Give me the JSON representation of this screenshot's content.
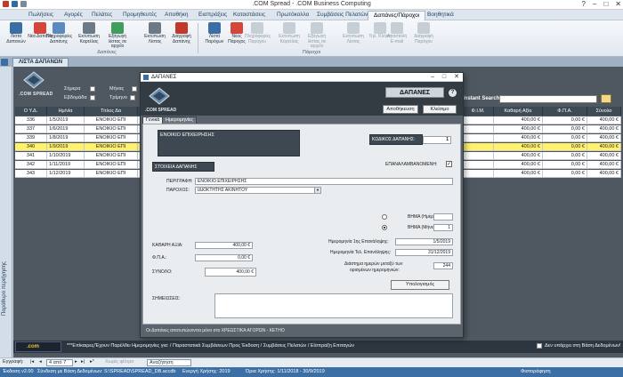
{
  "window": {
    "title": ".COM Spread - .COM Business Computing"
  },
  "menu": {
    "tabs": [
      "Πωλήσεις",
      "Αγορές",
      "Πελάτες",
      "Προμηθευτές",
      "Αποθήκη",
      "Εισπράξεις",
      "Καταστάσεις",
      "Πρωτόκολλο",
      "Συμβάσεις Πελατών",
      "Δαπάνες/Πάροχοι",
      "Βοηθητικά"
    ],
    "active_index": 9
  },
  "ribbon": {
    "buttons": [
      {
        "label": "Λίστα Δαπανών",
        "icon": "list-icon",
        "enabled": true
      },
      {
        "label": "Νέα Δαπάνη",
        "icon": "add-icon",
        "enabled": true
      },
      {
        "label": "Πληροφορίες Δαπάνης",
        "icon": "info-icon",
        "enabled": true
      },
      {
        "label": "Εκτύπωση Καρτέλας",
        "icon": "print-icon",
        "enabled": true
      },
      {
        "label": "Εξαγωγή λίστας σε αρχείο",
        "icon": "export-icon",
        "enabled": true
      },
      {
        "label": "Εκτύπωση Λίστας",
        "icon": "print-list-icon",
        "enabled": true
      },
      {
        "label": "Διαγραφή Δαπάνης",
        "icon": "delete-icon",
        "enabled": true
      },
      {
        "label": "Λίστα Παρόχων",
        "icon": "list-icon",
        "enabled": true
      },
      {
        "label": "Νέος Πάροχος",
        "icon": "add-icon",
        "enabled": true
      },
      {
        "label": "Πληροφορίες Παρόχου",
        "icon": "info-icon",
        "enabled": false
      },
      {
        "label": "Εκτύπωση Καρτέλας",
        "icon": "print-icon",
        "enabled": false
      },
      {
        "label": "Εξαγωγή λίστας σε αρχείο",
        "icon": "export-icon",
        "enabled": false
      },
      {
        "label": "Εκτύπωση Λίστας",
        "icon": "print-list-icon",
        "enabled": false
      },
      {
        "label": "Τηλ. Κλήση",
        "icon": "phone-icon",
        "enabled": false
      },
      {
        "label": "Αποστολή E-mail",
        "icon": "mail-icon",
        "enabled": false
      },
      {
        "label": "Διαγραφή Παρόχου",
        "icon": "delete-icon",
        "enabled": false
      }
    ],
    "groups": [
      "Δαπάνες",
      "Πάροχοι"
    ]
  },
  "doc_tab": {
    "label": "ΛΙΣΤΑ ΔΑΠΑΝΩΝ"
  },
  "left_panel": {
    "label": "Παράθυρο περιήγησης"
  },
  "list": {
    "logo_text": ".COM SPREAD",
    "filters": [
      "Σήμερα",
      "Εβδομάδα",
      "Μήνας",
      "Τρίμηνο"
    ],
    "search_label": "Instant Search:",
    "columns": [
      "Ο Υ.Δ.",
      "Ημ/νία",
      "Τίτλος Δα",
      "Φ.Ι.Μ.",
      "Καθαρή Αξία",
      "Φ.Π.Α.",
      "Σύνολο"
    ],
    "rows": [
      {
        "id": "336",
        "date": "1/5/2019",
        "title": "ΕΝΟΙΚΙΟ ΕΠΙ",
        "net": "400,00 €",
        "vat": "0,00 €",
        "total": "400,00 €",
        "selected": false
      },
      {
        "id": "337",
        "date": "1/6/2019",
        "title": "ΕΝΟΙΚΙΟ ΕΠΙ",
        "net": "400,00 €",
        "vat": "0,00 €",
        "total": "400,00 €",
        "selected": false
      },
      {
        "id": "339",
        "date": "1/8/2019",
        "title": "ΕΝΟΙΚΙΟ ΕΠΙ",
        "net": "400,00 €",
        "vat": "0,00 €",
        "total": "400,00 €",
        "selected": false
      },
      {
        "id": "340",
        "date": "1/9/2019",
        "title": "ΕΝΟΙΚΙΟ ΕΠΙ",
        "net": "400,00 €",
        "vat": "0,00 €",
        "total": "400,00 €",
        "selected": true
      },
      {
        "id": "341",
        "date": "1/10/2019",
        "title": "ΕΝΟΙΚΙΟ ΕΠΙ",
        "net": "400,00 €",
        "vat": "0,00 €",
        "total": "400,00 €",
        "selected": false
      },
      {
        "id": "342",
        "date": "1/11/2019",
        "title": "ΕΝΟΙΚΙΟ ΕΠΙ",
        "net": "400,00 €",
        "vat": "0,00 €",
        "total": "400,00 €",
        "selected": false
      },
      {
        "id": "343",
        "date": "1/12/2019",
        "title": "ΕΝΟΙΚΙΟ ΕΠΙ",
        "net": "400,00 €",
        "vat": "0,00 €",
        "total": "400,00 €",
        "selected": false
      }
    ]
  },
  "ticker": {
    "logo": ".com",
    "text": "***Επίκαιρες/Έχουν Παρέλθει Ημερομηνίες για: / Παραστατικά Συμβάσεων Προς Έκδοση / Συμβάσεις Πελατών / Είσπραξη Επιταγών",
    "checkbox_label": "Δεν υπάρχει στη Βάση Δεδομένων!"
  },
  "recnav": {
    "label": "Εγγραφή:",
    "position": "4 από 7",
    "filter": "Χωρίς φίλτρο",
    "search": "Αναζήτηση"
  },
  "statusbar": {
    "version": "Έκδοση v2.00",
    "db": "Σύνδεση με Βάση Δεδομένων: S:\\SPREAD\\SPREAD_DB.accdb",
    "year": "Ενεργή Χρήσης: 2019",
    "period": "Όρια Χρήσης: 1/11/2018 - 30/9/2019",
    "mode": "Φύλλο Δεδομένων",
    "numlock": "Φιστοράφηση"
  },
  "dialog": {
    "title": "ΔΑΠΑΝΕΣ",
    "logo_text": ".COM SPREAD",
    "banner": "ΔΑΠΑΝΕΣ",
    "help": "?",
    "save_label": "Αποθήκευση",
    "close_label": "Κλείσιμο",
    "tabs": [
      "Γενικά",
      "Ημερομηνίες"
    ],
    "header_title": "ΕΝΟΙΚΙΟ ΕΠΙΧΕΙΡΗΣΗΣ",
    "code_label": "ΚΩΔΙΚΟΣ ΔΑΠΑΝΗΣ:",
    "code_value": "1",
    "section_label": "ΣΤΟΙΧΕΙΑ ΔΑΠΑΝΗΣ",
    "recurring_label": "ΕΠΑΝΑΛΑΜΒΑΝΟΜΕΝΗ:",
    "description_label": "ΠΕΡΙΓΡΑΦΗ:",
    "description_value": "ΕΝΟΙΚΙΟ ΕΠΙΧΕΙΡΗΣΗΣ",
    "provider_label": "ΠΑΡΟΧΟΣ:",
    "provider_value": "ΙΔΙΟΚΤΗΤΗΣ ΑΚΙΝΗΤΟΥ",
    "step_days_label": "ΒΗΜΑ (Ημέρες):",
    "step_days_value": "",
    "step_months_label": "ΒΗΜΑ (Μήνες):",
    "step_months_value": "1",
    "first_date_label": "Ημερομηνία 1ης Επανάληψης:",
    "first_date_value": "1/5/2019",
    "last_date_label": "Ημερομηνία Τελ. Επανάληψης:",
    "last_date_value": "31/12/2019",
    "interval_label_1": "Διάστημα ημερών μεταξύ των",
    "interval_label_2": "ορισμένων ημερομηνιών:",
    "interval_value": "244",
    "net_label": "ΚΑΘΑΡΗ ΑΞΙΑ:",
    "net_value": "400,00 €",
    "vat_label": "Φ.Π.Α.:",
    "vat_value": "0,00 €",
    "total_label": "ΣΥΝΟΛΟ:",
    "total_value": "400,00 €",
    "calc_label": "Υπολογισμός",
    "notes_label": "ΣΗΜΕΙΩΣΕΙΣ:",
    "notes_value": "",
    "footer": "Οι Δαπάνες αποτυπώνονται μόνο στο ΧΡΕΩΣΤΙΚΑ ΑΓΟΡΩΝ - ΚΕΤΗΟ"
  },
  "colors": {
    "accent": "#3c6fa5",
    "selected_row": "#fff26a",
    "dark_panel": "#333b43"
  }
}
